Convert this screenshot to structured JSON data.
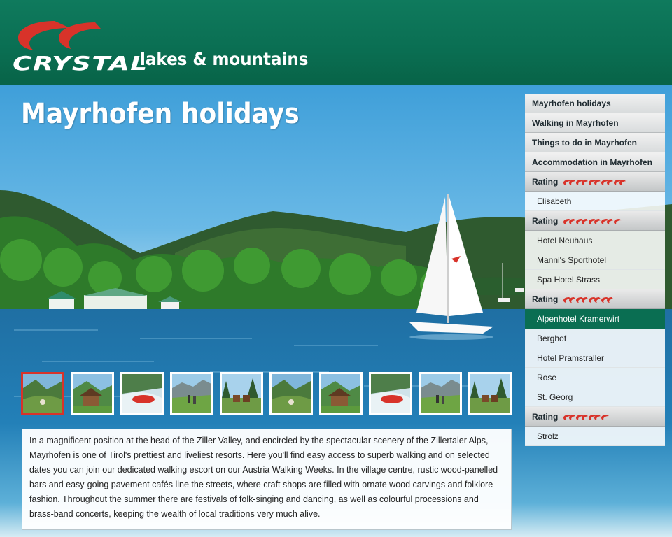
{
  "brand": {
    "name": "CRYSTAL",
    "tagline": "lakes & mountains"
  },
  "page": {
    "title": "Mayrhofen holidays"
  },
  "description": "In a magnificent position at the head of the Ziller Valley, and encircled by the spectacular scenery of the Zillertaler Alps, Mayrhofen is one of Tirol's prettiest and liveliest resorts. Here you'll find easy access to superb walking and on selected dates you can join our dedicated walking escort on our Austria Walking Weeks. In the village centre, rustic wood-panelled bars and easy-going pavement cafés line the streets, where craft shops are filled with ornate wood carvings and folklore fashion. Throughout the summer there are festivals of folk-singing and dancing, as well as colourful processions and brass-band concerts, keeping the wealth of local traditions very much alive.",
  "nav": {
    "links": [
      "Mayrhofen holidays",
      "Walking in Mayrhofen",
      "Things to do in Mayrhofen",
      "Accommodation in Mayrhofen"
    ],
    "rating_label": "Rating",
    "groups": [
      {
        "rating": 5,
        "hotels": [
          "Elisabeth"
        ]
      },
      {
        "rating": 4.5,
        "hotels": [
          "Hotel Neuhaus",
          "Manni's Sporthotel",
          "Spa Hotel Strass"
        ]
      },
      {
        "rating": 4,
        "hotels": [
          "Alpenhotel Kramerwirt",
          "Berghof",
          "Hotel Pramstraller",
          "Rose",
          "St. Georg"
        ]
      },
      {
        "rating": 3.5,
        "hotels": [
          "Strolz"
        ]
      }
    ],
    "selected_hotel": "Alpenhotel Kramerwirt"
  },
  "thumbnails": {
    "count": 10,
    "active_index": 0,
    "subjects": [
      "valley",
      "chalet",
      "rafting",
      "hikers",
      "riders",
      "valley",
      "chalet",
      "rafting",
      "hikers",
      "riders"
    ]
  },
  "colors": {
    "brand_green": "#0a6e52",
    "brand_red": "#d8332a",
    "selected": "#0a6e52"
  },
  "icons": {
    "rating": "crystal-rating-icon"
  }
}
